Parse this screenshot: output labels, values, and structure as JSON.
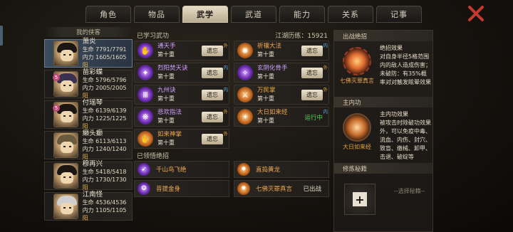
{
  "tabs": [
    "角色",
    "物品",
    "武学",
    "武道",
    "能力",
    "关系",
    "记事"
  ],
  "active_tab": 2,
  "left_header": "我的侠客",
  "characters": [
    {
      "name": "萧炎",
      "hp": "生命 7791/7791",
      "mp": "内力 1605/1605",
      "side": "阳",
      "badge": ""
    },
    {
      "name": "苗彩蝶",
      "hp": "生命 5796/5796",
      "mp": "内力 2005/2005",
      "side": "阳",
      "badge": "5"
    },
    {
      "name": "付瑶琴",
      "hp": "生命 6139/6139",
      "mp": "内力 1225/1225",
      "side": "阳",
      "badge": "5"
    },
    {
      "name": "癞头癫",
      "hp": "生命 6113/6113",
      "mp": "内力 1240/1240",
      "side": "阳",
      "badge": ""
    },
    {
      "name": "穆再兴",
      "hp": "生命 5418/5418",
      "mp": "内力 1730/1730",
      "side": "阳",
      "badge": ""
    },
    {
      "name": "江南怪",
      "hp": "生命 4536/4536",
      "mp": "内力 1105/1105",
      "side": "阳",
      "badge": ""
    }
  ],
  "learned": {
    "title": "已学习武功",
    "experience_label": "江湖历练：",
    "experience_value": "15921",
    "skills": [
      {
        "name": "通天手",
        "level": "第十重",
        "action": "遗忘",
        "tag": "外",
        "color": "purple"
      },
      {
        "name": "祈禳大法",
        "level": "第十重",
        "action": "遗忘",
        "tag": "内",
        "color": "orange"
      },
      {
        "name": "烈阳焚天诀",
        "level": "第十重",
        "action": "遗忘",
        "tag": "内",
        "color": "purple"
      },
      {
        "name": "玄阴化骨手",
        "level": "第十重",
        "action": "遗忘",
        "tag": "外",
        "color": "purple"
      },
      {
        "name": "九州诀",
        "level": "第十重",
        "action": "遗忘",
        "tag": "内",
        "color": "purple"
      },
      {
        "name": "万民掌",
        "level": "第十重",
        "action": "遗忘",
        "tag": "外",
        "color": "orange"
      },
      {
        "name": "悲欢指法",
        "level": "第十重",
        "action": "遗忘",
        "tag": "外",
        "color": "purple"
      },
      {
        "name": "大日如来经",
        "level": "第十重",
        "action": "运行中",
        "tag": "内",
        "color": "orange"
      },
      {
        "name": "如来神掌",
        "level": "第十重",
        "action": "遗忘",
        "tag": "外",
        "color": "orange"
      }
    ]
  },
  "tricks": {
    "title": "已领悟绝招",
    "items": [
      {
        "name": "千山鸟飞绝",
        "state": ""
      },
      {
        "name": "直捣黄龙",
        "state": ""
      },
      {
        "name": "菩提金身",
        "state": ""
      },
      {
        "name": "七佛灭罪真言",
        "state": "已出战"
      }
    ]
  },
  "detail": {
    "battle_title": "出战绝招",
    "battle_name": "七佛灭罪真言",
    "battle_desc_title": "绝招效果",
    "battle_desc": "对自身半径5格范围内的敌人造成伤害；未破防：有35%概率对对触发眩晕效果",
    "inner_title": "主内功",
    "inner_name": "大日如来经",
    "inner_desc_title": "主内功效果",
    "inner_desc": "被攻击时除破功效果外，可以免疫中毒、流血、内伤、封穴、致盲、缴械、卸甲、击退、破绽等",
    "cultivation_title": "修炼秘籍",
    "choose_label": "--选择秘籍--"
  }
}
